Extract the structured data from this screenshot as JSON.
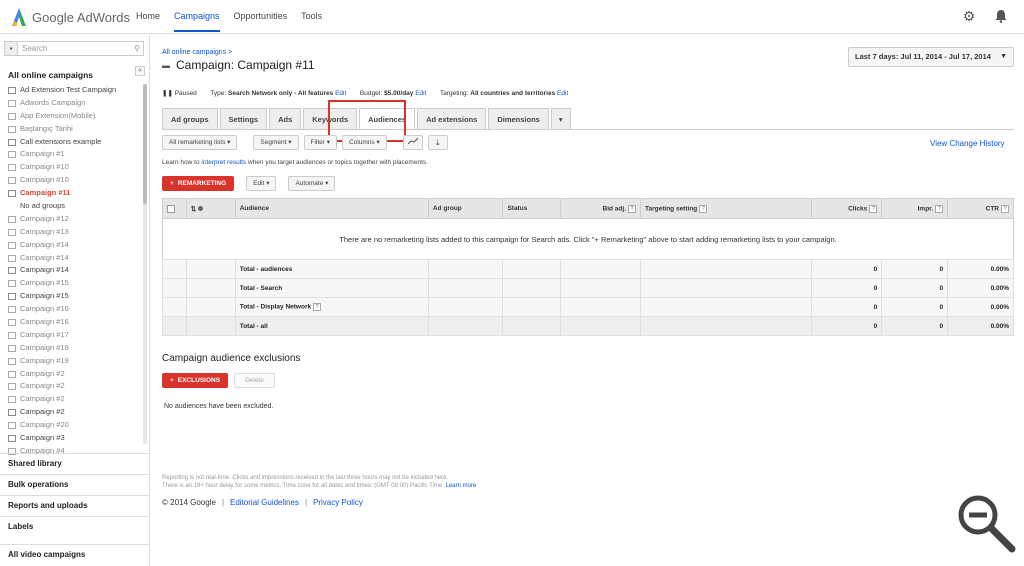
{
  "app": {
    "logo_text": "Google AdWords",
    "nav": [
      "Home",
      "Campaigns",
      "Opportunities",
      "Tools"
    ],
    "active_nav": "Campaigns"
  },
  "sidebar": {
    "search_placeholder": "Search",
    "title": "All online campaigns",
    "collapse": "«",
    "campaigns": [
      {
        "label": "Ad Extension Test Campaign",
        "state": "enabled"
      },
      {
        "label": "Adwords Campaign",
        "state": "paused"
      },
      {
        "label": "App Extension(Mobile)",
        "state": "paused"
      },
      {
        "label": "Başlangıç Tarihi",
        "state": "paused"
      },
      {
        "label": "Call extensions example",
        "state": "enabled"
      },
      {
        "label": "Campaign #1",
        "state": "paused"
      },
      {
        "label": "Campaign #10",
        "state": "paused"
      },
      {
        "label": "Campaign #10",
        "state": "paused"
      },
      {
        "label": "Campaign #11",
        "state": "active"
      },
      {
        "label": "No ad groups",
        "state": "sub"
      },
      {
        "label": "Campaign #12",
        "state": "paused"
      },
      {
        "label": "Campaign #13",
        "state": "paused"
      },
      {
        "label": "Campaign #14",
        "state": "paused"
      },
      {
        "label": "Campaign #14",
        "state": "paused"
      },
      {
        "label": "Campaign #14",
        "state": "enabled"
      },
      {
        "label": "Campaign #15",
        "state": "paused"
      },
      {
        "label": "Campaign #15",
        "state": "enabled"
      },
      {
        "label": "Campaign #16",
        "state": "paused"
      },
      {
        "label": "Campaign #16",
        "state": "paused"
      },
      {
        "label": "Campaign #17",
        "state": "paused"
      },
      {
        "label": "Campaign #18",
        "state": "paused"
      },
      {
        "label": "Campaign #19",
        "state": "paused"
      },
      {
        "label": "Campaign #2",
        "state": "paused"
      },
      {
        "label": "Campaign #2",
        "state": "paused"
      },
      {
        "label": "Campaign #2",
        "state": "paused"
      },
      {
        "label": "Campaign #2",
        "state": "enabled"
      },
      {
        "label": "Campaign #20",
        "state": "paused"
      },
      {
        "label": "Campaign #3",
        "state": "enabled"
      },
      {
        "label": "Campaign #4",
        "state": "paused"
      }
    ],
    "sections": [
      "Shared library",
      "Bulk operations",
      "Reports and uploads",
      "Labels",
      "All video campaigns"
    ]
  },
  "main": {
    "breadcrumb": "All online campaigns >",
    "campaign_title": "Campaign: Campaign #11",
    "date_range": "Last 7 days: Jul 11, 2014 - Jul 17, 2014",
    "status": {
      "paused": "Paused",
      "type_label": "Type:",
      "type_value": "Search Network only - All features",
      "edit": "Edit",
      "budget_label": "Budget:",
      "budget_value": "$5.00/day",
      "targeting_label": "Targeting:",
      "targeting_value": "All countries and territories"
    },
    "tabs": [
      "Ad groups",
      "Settings",
      "Ads",
      "Keywords",
      "Audiences",
      "Ad extensions",
      "Dimensions"
    ],
    "active_tab": "Audiences",
    "toolbar": {
      "lists": "All remarketing lists ▾",
      "segment": "Segment ▾",
      "filter": "Filter ▾",
      "columns": "Columns ▾"
    },
    "view_history": "View Change History",
    "learn": {
      "pre": "Learn how to ",
      "link": "interpret results",
      "post": " when you target audiences or topics together with placements."
    },
    "remarketing_btn": "REMARKETING",
    "edit_btn": "Edit ▾",
    "automate_btn": "Automate ▾",
    "table": {
      "columns": [
        "Audience",
        "Ad group",
        "Status",
        "Bid adj.",
        "Targeting setting",
        "Clicks",
        "Impr.",
        "CTR"
      ],
      "empty_message": "There are no remarketing lists added to this campaign for Search ads. Click \"+ Remarketing\" above to start adding remarketing lists to your campaign.",
      "totals": [
        {
          "label": "Total - audiences",
          "clicks": "0",
          "impr": "0",
          "ctr": "0.00%"
        },
        {
          "label": "Total - Search",
          "clicks": "0",
          "impr": "0",
          "ctr": "0.00%"
        },
        {
          "label": "Total - Display Network",
          "clicks": "0",
          "impr": "0",
          "ctr": "0.00%"
        },
        {
          "label": "Total - all",
          "clicks": "0",
          "impr": "0",
          "ctr": "0.00%"
        }
      ]
    },
    "exclusions": {
      "title": "Campaign audience exclusions",
      "btn": "EXCLUSIONS",
      "delete": "Delete",
      "empty": "No audiences have been excluded."
    },
    "footnote": {
      "line1": "Reporting is not real-time. Clicks and impressions received in the last three hours may not be included here.",
      "line2_pre": "There is an 18+ hour delay for some metrics. Time zone for all dates and times: (GMT-08:00) Pacific Time. ",
      "line2_link": "Learn more"
    },
    "footer": {
      "copyright": "© 2014 Google",
      "guidelines": "Editorial Guidelines",
      "privacy": "Privacy Policy"
    }
  },
  "colors": {
    "accent": "#1155cc",
    "red": "#d9342b",
    "highlight": "#d9342b"
  }
}
